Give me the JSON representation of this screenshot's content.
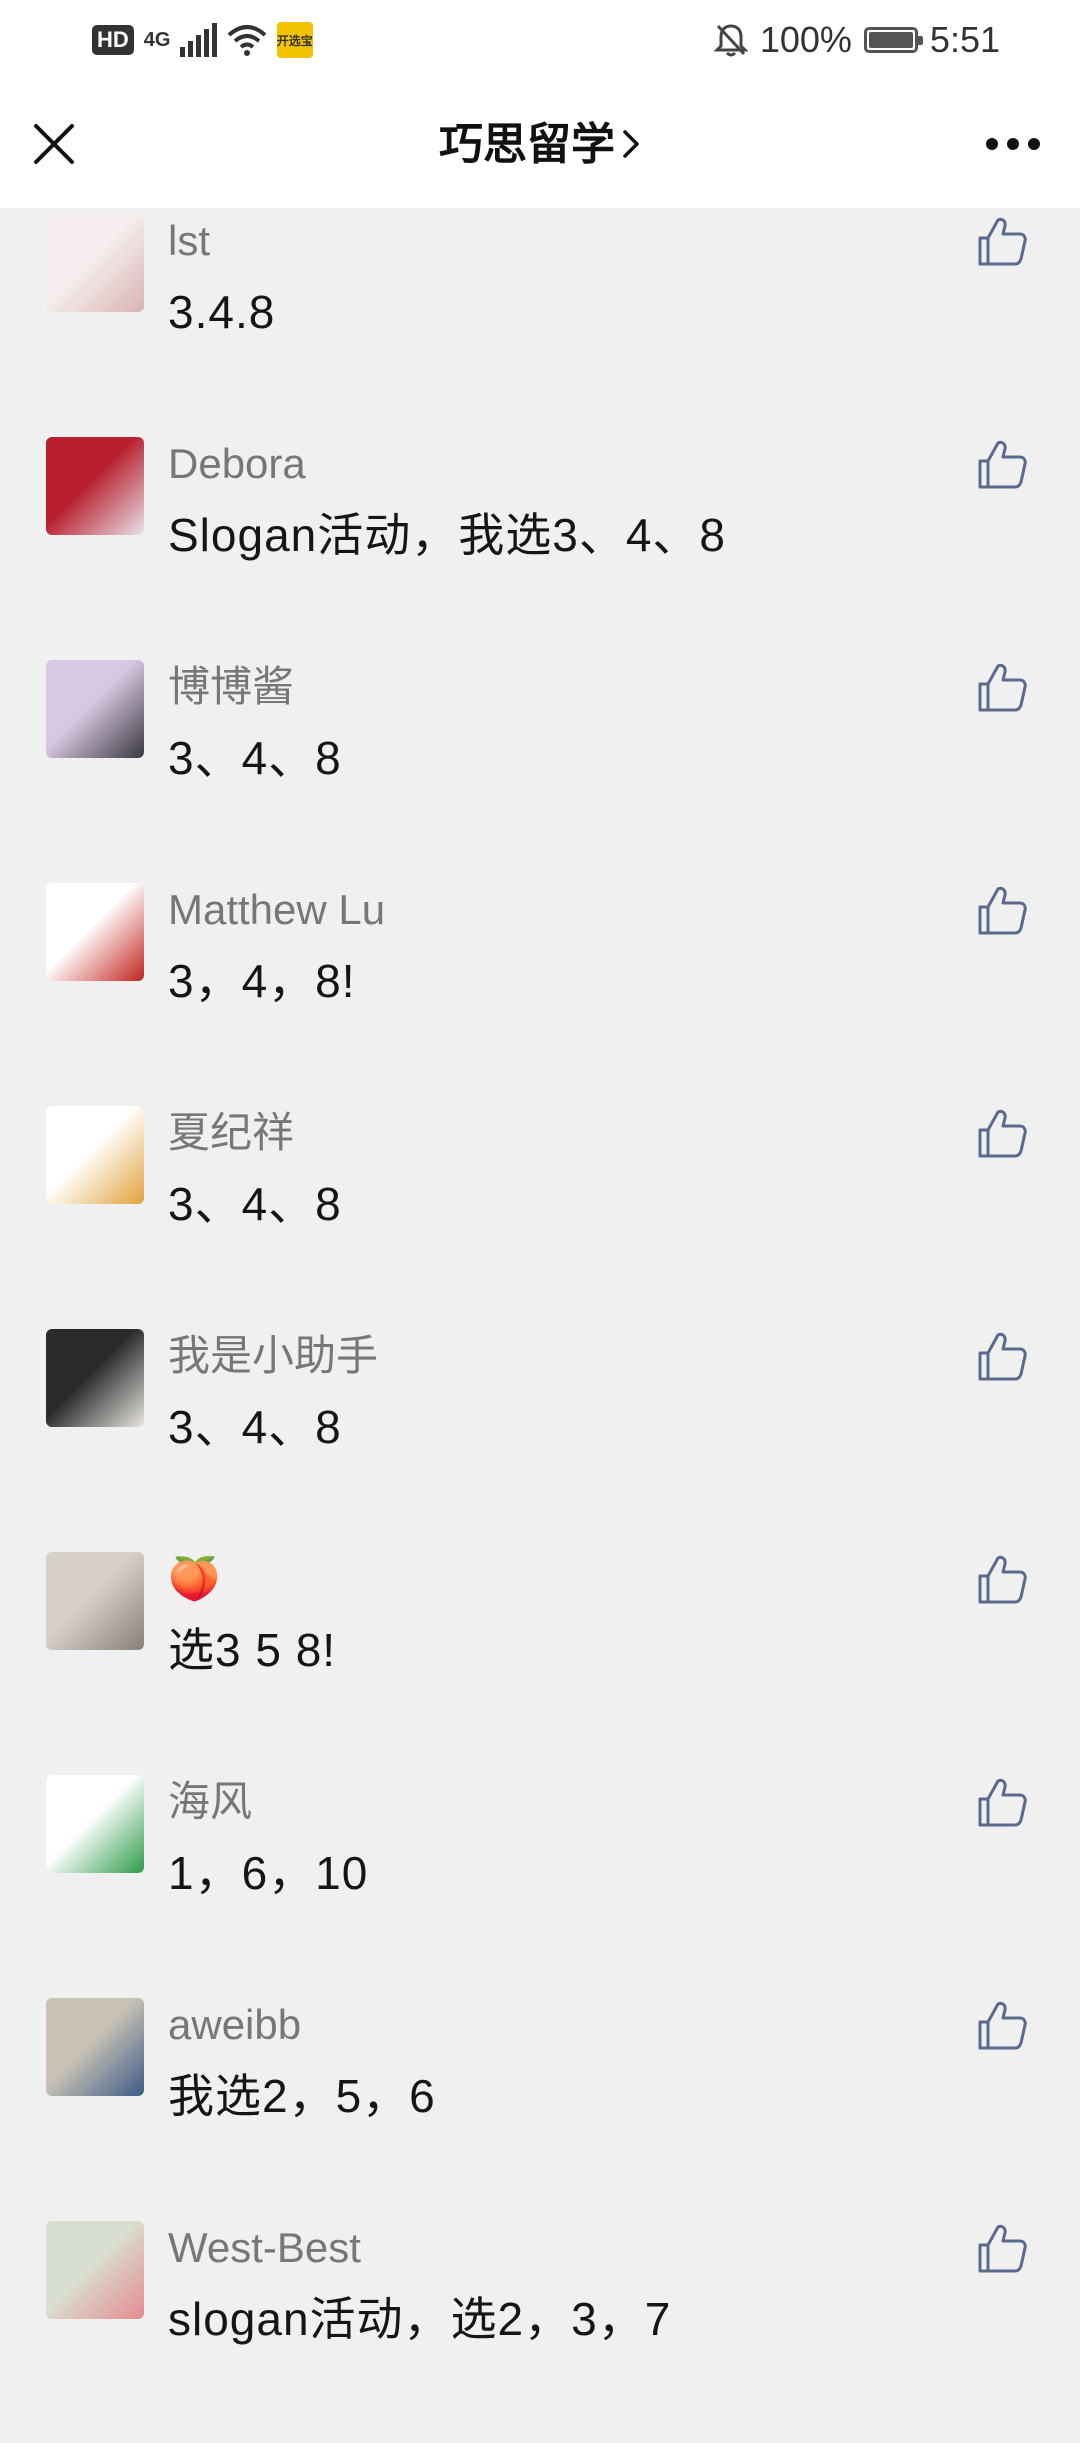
{
  "status_bar": {
    "hd": "HD",
    "network": "4G",
    "battery_percent": "100%",
    "time": "5:51",
    "app_badge": "开选宝"
  },
  "nav": {
    "title": "巧思留学"
  },
  "comments": [
    {
      "name": "lst",
      "text": "3.4.8",
      "avatar_colors": [
        "#f6eeee",
        "#d9b3b3"
      ]
    },
    {
      "name": "Debora",
      "text": "Slogan活动，我选3、4、8",
      "avatar_colors": [
        "#b8202f",
        "#e7e2ea"
      ]
    },
    {
      "name": "博博酱",
      "text": "3、4、8",
      "avatar_colors": [
        "#d8c8e2",
        "#3a3840"
      ]
    },
    {
      "name": "Matthew Lu",
      "text": "3，4，8!",
      "avatar_colors": [
        "#ffffff",
        "#c3231e"
      ]
    },
    {
      "name": "夏纪祥",
      "text": "3、4、8",
      "avatar_colors": [
        "#ffffff",
        "#e0a13a"
      ]
    },
    {
      "name": "我是小助手",
      "text": "3、4、8",
      "avatar_colors": [
        "#2a2a2a",
        "#e9e6e1"
      ]
    },
    {
      "name": "🍑",
      "text": "选3 5 8!",
      "avatar_colors": [
        "#d7d0c8",
        "#8a8078"
      ]
    },
    {
      "name": "海风",
      "text": "1，6，10",
      "avatar_colors": [
        "#ffffff",
        "#2e9b4a"
      ]
    },
    {
      "name": "aweibb",
      "text": "我选2，5，6",
      "avatar_colors": [
        "#c9c2b3",
        "#3d5a88"
      ]
    },
    {
      "name": "West-Best",
      "text": "slogan活动，选2，3，7",
      "avatar_colors": [
        "#d8dfd0",
        "#e58b8f"
      ]
    }
  ]
}
